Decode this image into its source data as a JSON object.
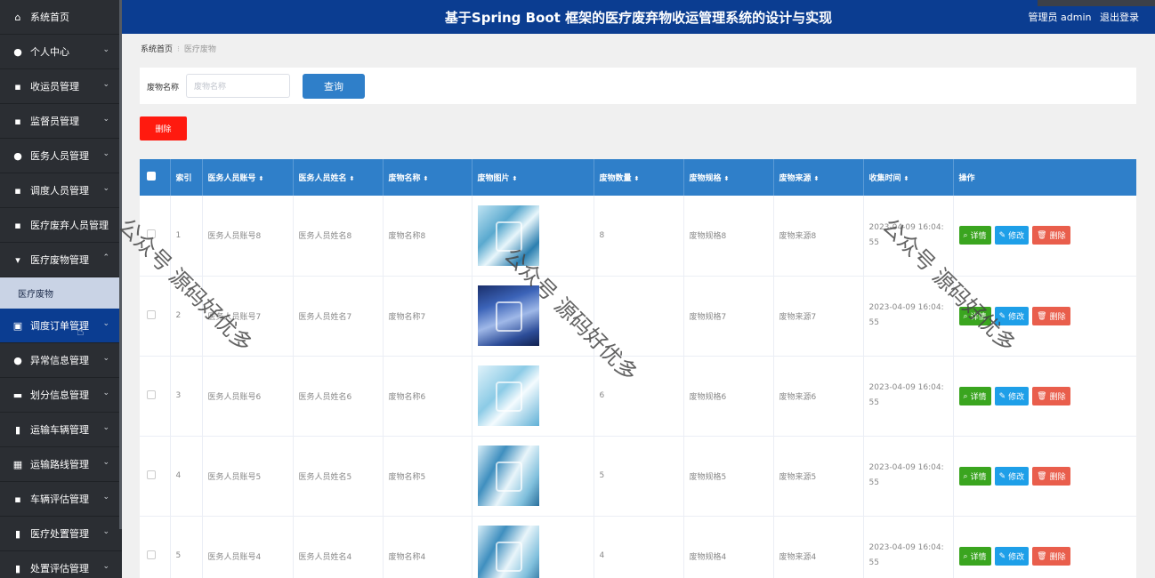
{
  "sidebar": {
    "items": [
      {
        "label": "系统首页",
        "icon": "home-icon",
        "glyph": "⌂",
        "arrow": ""
      },
      {
        "label": "个人中心",
        "icon": "user-icon",
        "glyph": "●",
        "arrow": "⌄"
      },
      {
        "label": "收运员管理",
        "icon": "grid-icon",
        "glyph": "▪",
        "arrow": "⌄"
      },
      {
        "label": "监督员管理",
        "icon": "grid-icon",
        "glyph": "▪",
        "arrow": "⌄"
      },
      {
        "label": "医务人员管理",
        "icon": "user-icon",
        "glyph": "●",
        "arrow": "⌄"
      },
      {
        "label": "调度人员管理",
        "icon": "grid-icon",
        "glyph": "▪",
        "arrow": "⌄"
      },
      {
        "label": "医疗废弃人员管理",
        "icon": "grid-icon",
        "glyph": "▪",
        "arrow": ""
      },
      {
        "label": "医疗废物管理",
        "icon": "pin-icon",
        "glyph": "▾",
        "arrow": "⌃"
      }
    ],
    "submenu": {
      "label": "医疗废物"
    },
    "items_after": [
      {
        "label": "调度订单管理",
        "icon": "chart-icon",
        "glyph": "▣",
        "arrow": "⌄"
      },
      {
        "label": "异常信息管理",
        "icon": "user-icon",
        "glyph": "●",
        "arrow": "⌄"
      },
      {
        "label": "划分信息管理",
        "icon": "briefcase-icon",
        "glyph": "▬",
        "arrow": "⌄"
      },
      {
        "label": "运输车辆管理",
        "icon": "clipboard-icon",
        "glyph": "▮",
        "arrow": "⌄"
      },
      {
        "label": "运输路线管理",
        "icon": "table-icon",
        "glyph": "▦",
        "arrow": "⌄"
      },
      {
        "label": "车辆评估管理",
        "icon": "grid-icon",
        "glyph": "▪",
        "arrow": "⌄"
      },
      {
        "label": "医疗处置管理",
        "icon": "clipboard-icon",
        "glyph": "▮",
        "arrow": "⌄"
      },
      {
        "label": "处置评估管理",
        "icon": "clipboard-icon",
        "glyph": "▮",
        "arrow": "⌄"
      }
    ]
  },
  "header": {
    "title": "基于Spring Boot 框架的医疗废弃物收运管理系统的设计与实现",
    "user_label": "管理员 admin",
    "logout_label": "退出登录"
  },
  "breadcrumb": {
    "home": "系统首页",
    "current": "医疗废物"
  },
  "search": {
    "label": "废物名称",
    "placeholder": "废物名称",
    "button": "查询"
  },
  "batch_delete_label": "删除",
  "table": {
    "columns": [
      "索引",
      "医务人员账号",
      "医务人员姓名",
      "废物名称",
      "废物图片",
      "废物数量",
      "废物规格",
      "废物来源",
      "收集时间",
      "操作"
    ],
    "sort_glyph": "⬍",
    "actions": {
      "detail": "详情",
      "edit": "修改",
      "delete": "删除"
    },
    "rows": [
      {
        "index": "1",
        "account": "医务人员账号8",
        "name": "医务人员姓名8",
        "waste": "废物名称8",
        "qty": "8",
        "spec": "废物规格8",
        "source": "废物来源8",
        "time_a": "2023-04-09 16:04:",
        "time_b": "55"
      },
      {
        "index": "2",
        "account": "医务人员账号7",
        "name": "医务人员姓名7",
        "waste": "废物名称7",
        "qty": "",
        "spec": "废物规格7",
        "source": "废物来源7",
        "time_a": "2023-04-09 16:04:",
        "time_b": "55"
      },
      {
        "index": "3",
        "account": "医务人员账号6",
        "name": "医务人员姓名6",
        "waste": "废物名称6",
        "qty": "6",
        "spec": "废物规格6",
        "source": "废物来源6",
        "time_a": "2023-04-09 16:04:",
        "time_b": "55"
      },
      {
        "index": "4",
        "account": "医务人员账号5",
        "name": "医务人员姓名5",
        "waste": "废物名称5",
        "qty": "5",
        "spec": "废物规格5",
        "source": "废物来源5",
        "time_a": "2023-04-09 16:04:",
        "time_b": "55"
      },
      {
        "index": "5",
        "account": "医务人员账号4",
        "name": "医务人员姓名4",
        "waste": "废物名称4",
        "qty": "4",
        "spec": "废物规格4",
        "source": "废物来源4",
        "time_a": "2023-04-09 16:04:",
        "time_b": "55"
      }
    ]
  },
  "watermark": "公众号 源码好优多"
}
